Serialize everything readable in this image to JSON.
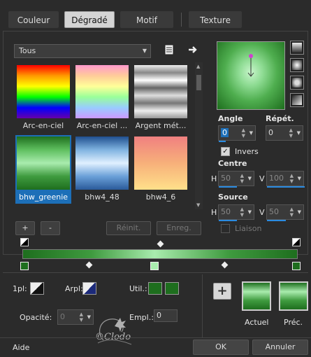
{
  "tabs": [
    {
      "label": "Couleur",
      "active": false
    },
    {
      "label": "Dégradé",
      "active": true
    },
    {
      "label": "Motif",
      "active": false
    },
    {
      "label": "Texture",
      "active": false
    }
  ],
  "category": {
    "value": "Tous"
  },
  "gallery": [
    {
      "label": "Arc-en-ciel",
      "selected": false
    },
    {
      "label": "Arc-en-ciel ...",
      "selected": false
    },
    {
      "label": "Argent mét...",
      "selected": false
    },
    {
      "label": "bhw_greenie",
      "selected": true
    },
    {
      "label": "bhw4_48",
      "selected": false
    },
    {
      "label": "bhw4_6",
      "selected": false
    }
  ],
  "buttons": {
    "add": "+",
    "remove": "-",
    "reset": "Réinit.",
    "save": "Enreg."
  },
  "angle": {
    "label": "Angle",
    "value": "0"
  },
  "repeat": {
    "label": "Répét.",
    "value": "0"
  },
  "invert": {
    "label": "Invers",
    "checked": true
  },
  "center": {
    "label": "Centre",
    "h_label": "H",
    "h": "50",
    "v_label": "V",
    "v": "100"
  },
  "source": {
    "label": "Source",
    "h_label": "H",
    "h": "50",
    "v_label": "V",
    "v": "50"
  },
  "link": {
    "label": "Liaison",
    "checked": false
  },
  "stops": {
    "first_label": "1pl:",
    "arpl_label": "Arpl:",
    "util_label": "Util.:",
    "opacity_label": "Opacité:",
    "opacity_value": "0",
    "position_label": "Empl.:",
    "position_value": "0"
  },
  "previews": {
    "add_button": "+",
    "current": "Actuel",
    "previous": "Préc."
  },
  "footer": {
    "help": "Aide",
    "ok": "OK",
    "cancel": "Annuler"
  },
  "watermark": "©Clodo",
  "colors": {
    "accent": "#2a8be0",
    "dark_green": "#1e6e1e",
    "light_green": "#a9ecae"
  }
}
